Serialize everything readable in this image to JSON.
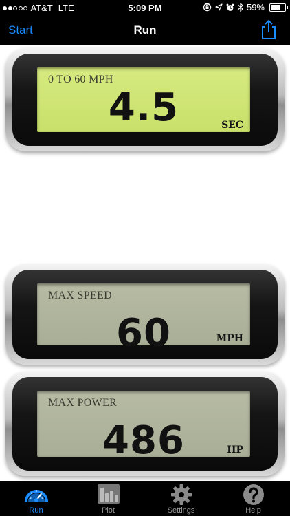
{
  "status_bar": {
    "signal_dots_filled": 2,
    "signal_dots_total": 5,
    "carrier": "AT&T",
    "network": "LTE",
    "time": "5:09 PM",
    "battery_percent": "59%",
    "battery_level": 0.59,
    "icons": [
      "orientation-lock-icon",
      "location-arrow-icon",
      "alarm-icon",
      "bluetooth-icon",
      "battery-icon"
    ]
  },
  "nav": {
    "left_button": "Start",
    "title": "Run",
    "right_icon": "share-icon",
    "accent_color": "#1a8cff"
  },
  "gauges": [
    {
      "label": "0 TO 60 MPH",
      "value": "4.5",
      "unit": "SEC",
      "screen_color": "#cde36f"
    },
    {
      "label": "MAX SPEED",
      "value": "60",
      "unit": "MPH",
      "screen_color": "#aeb39b"
    },
    {
      "label": "MAX POWER",
      "value": "486",
      "unit": "HP",
      "screen_color": "#aeb39b"
    }
  ],
  "tabs": [
    {
      "label": "Run",
      "icon": "speedometer-icon",
      "active": true
    },
    {
      "label": "Plot",
      "icon": "bar-chart-icon",
      "active": false
    },
    {
      "label": "Settings",
      "icon": "gear-icon",
      "active": false
    },
    {
      "label": "Help",
      "icon": "question-icon",
      "active": false
    }
  ]
}
